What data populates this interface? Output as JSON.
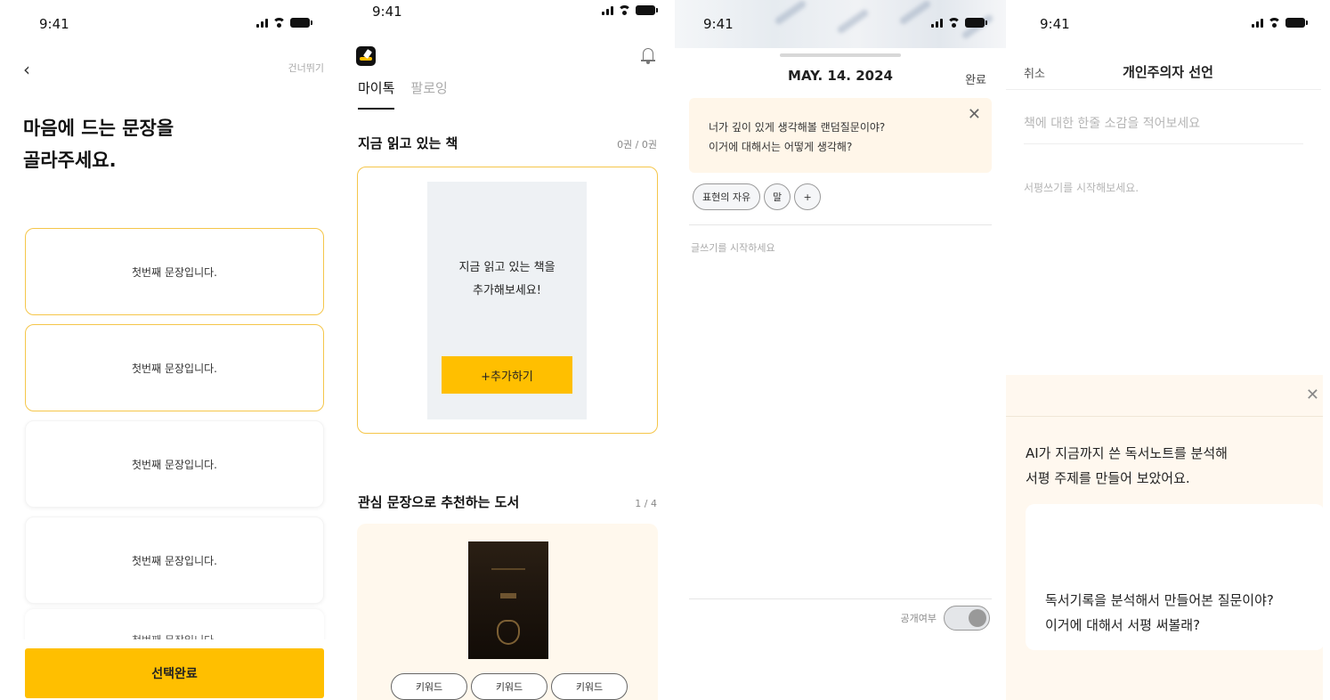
{
  "status_time": "9:41",
  "screen1": {
    "skip_label": "건너뛰기",
    "title": "마음에 드는 문장을\n골라주세요.",
    "sentences": [
      {
        "text": "첫번째 문장입니다.",
        "selected": true
      },
      {
        "text": "첫번째 문장입니다.",
        "selected": true
      },
      {
        "text": "첫번째 문장입니다.",
        "selected": false
      },
      {
        "text": "첫번째 문장입니다.",
        "selected": false
      }
    ],
    "partial_sentence": "첫번째 문장입니다.",
    "confirm_label": "선택완료"
  },
  "screen2": {
    "tabs": [
      "마이톡",
      "팔로잉"
    ],
    "active_tab": "마이톡",
    "reading_title": "지금 읽고 있는 책",
    "reading_count": "0권 / 0권",
    "empty_message": "지금 읽고 있는 책을\n추가해보세요!",
    "add_label": "+추가하기",
    "rec_title": "관심 문장으로 추천하는 도서",
    "rec_page": "1 / 4",
    "keywords": [
      "키워드",
      "키워드",
      "키워드"
    ]
  },
  "screen3": {
    "date": "MAY. 14. 2024",
    "done_label": "완료",
    "question": "너가 깊이 있게 생각해볼 랜덤질문이야?\n이거에 대해서는 어떻게 생각해?",
    "tags": [
      "표현의 자유",
      "말"
    ],
    "add_tag": "+",
    "placeholder": "글쓰기를 시작하세요",
    "public_label": "공개여부"
  },
  "screen4": {
    "cancel_label": "취소",
    "title": "개인주의자 선언",
    "oneline_placeholder": "책에 대한 한줄 소감을 적어보세요",
    "review_placeholder": "서평쓰기를 시작해보세요.",
    "ai_message": "AI가 지금까지 쓴 독서노트를 분석해\n서평 주제를 만들어 보았어요.",
    "ai_question": "독서기록을 분석해서 만들어본 질문이야?\n이거에 대해서 서평 써볼래?"
  },
  "colors": {
    "accent": "#ffbf00",
    "selected_border": "#f5c64a",
    "panel_bg": "#fff8ef"
  },
  "icons": [
    "back-chevron-icon",
    "app-logo-icon",
    "bell-icon",
    "close-icon",
    "signal-icon",
    "wifi-icon",
    "battery-icon"
  ]
}
